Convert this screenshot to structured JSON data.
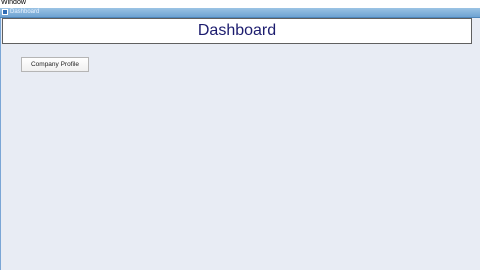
{
  "menubar": {
    "items": [
      {
        "label": "Window"
      }
    ]
  },
  "window": {
    "title": "Dashboard",
    "icon": "app-window-icon"
  },
  "main": {
    "page_title": "Dashboard",
    "buttons": [
      {
        "label": "Company Profile"
      }
    ]
  },
  "colors": {
    "background": "#e8ecf4",
    "titlebar": "#8ab4de",
    "title_text": "#1c1c6e",
    "panel": "#ffffff"
  }
}
